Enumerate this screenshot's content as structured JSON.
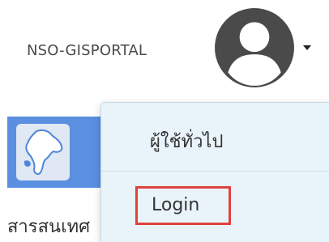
{
  "header": {
    "username": "NSO-GISPORTAL",
    "avatar_icon": "user-circle-icon",
    "caret_icon": "caret-down-icon"
  },
  "background": {
    "logo_icon": "thailand-map-icon",
    "text": "สารสนเทศ"
  },
  "dropdown": {
    "items": [
      {
        "label": "ผู้ใช้ทั่วไป"
      },
      {
        "label": "Login"
      }
    ]
  },
  "colors": {
    "dropdown_bg": "#e9f4fa",
    "highlight_border": "#e0413d",
    "avatar": "#4a4a4a",
    "banner": "#5b8fe0"
  }
}
